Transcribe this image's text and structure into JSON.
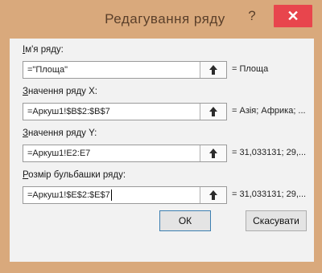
{
  "window": {
    "title": "Редагування ряду",
    "help_label": "?",
    "close_label": "✕"
  },
  "fields": [
    {
      "label_hotkey": "І",
      "label_rest": "м'я ряду:",
      "value": "=\"Площа\"",
      "preview": "= Площа"
    },
    {
      "label_hotkey": "З",
      "label_rest": "начення ряду X:",
      "value": "=Аркуш1!$B$2:$B$7",
      "preview": "= Азія; Африка; ..."
    },
    {
      "label_hotkey": "З",
      "label_rest": "начення ряду Y:",
      "value": "=Аркуш1!E2:E7",
      "preview": "= 31,033131; 29,..."
    },
    {
      "label_hotkey": "Р",
      "label_rest": "озмір бульбашки ряду:",
      "value": "=Аркуш1!$E$2:$E$7",
      "preview": "= 31,033131; 29,..."
    }
  ],
  "buttons": {
    "ok_label": "ОК",
    "cancel_label": "Скасувати"
  },
  "colors": {
    "frame": "#d9a97c",
    "close_button": "#e8454d",
    "dialog_body": "#f2f2f2"
  },
  "icons": {
    "range_picker": "collapse-range-arrow-icon"
  }
}
